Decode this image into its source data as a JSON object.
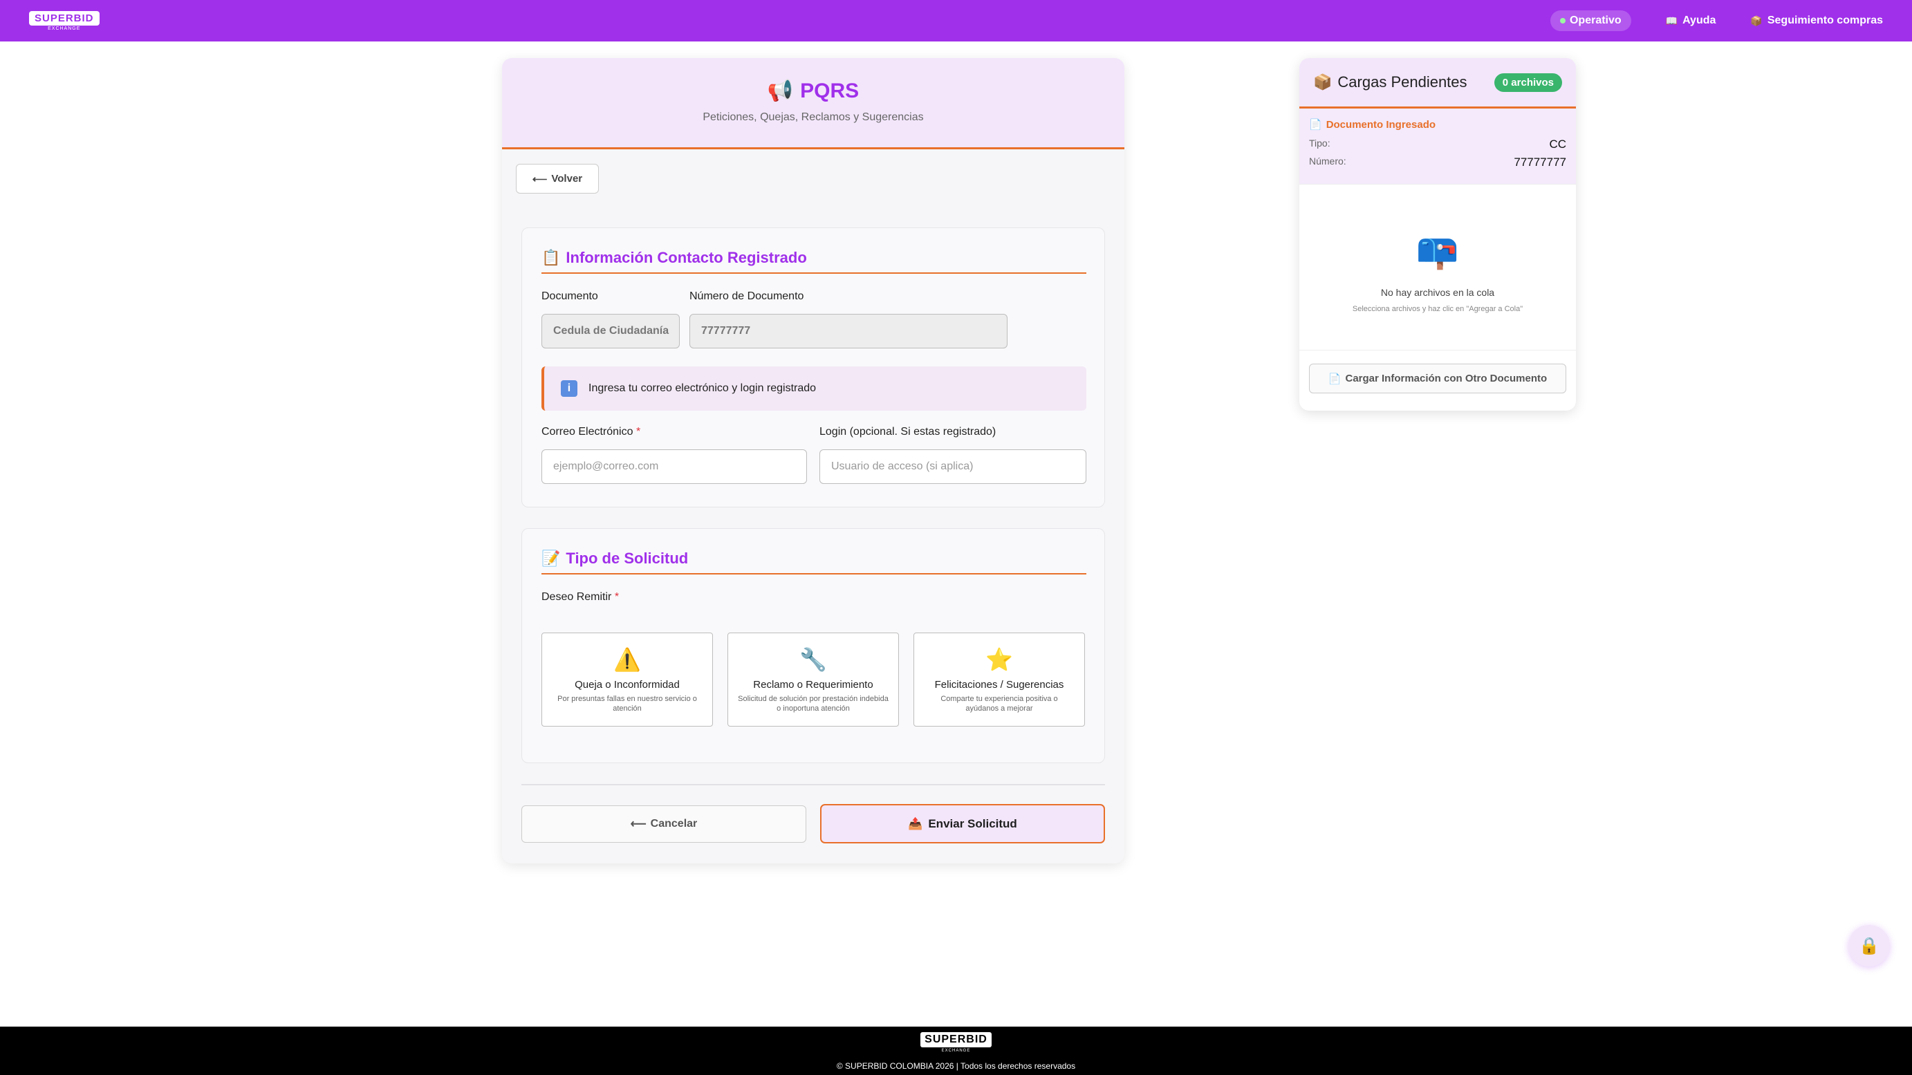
{
  "header": {
    "logo": "SUPERBID",
    "logo_sub": "EXCHANGE",
    "status": "Operativo",
    "help": "Ayuda",
    "tracking": "Seguimiento compras"
  },
  "main": {
    "title": "PQRS",
    "subtitle": "Peticiones, Quejas, Reclamos y Sugerencias",
    "back_label": "Volver",
    "contact_section": {
      "title": "Información Contacto Registrado",
      "doc_label": "Documento",
      "doc_value": "Cedula de Ciudadanía",
      "number_label": "Número de Documento",
      "number_value": "77777777",
      "info_text": "Ingresa tu correo electrónico y login registrado",
      "email_label": "Correo Electrónico",
      "email_placeholder": "ejemplo@correo.com",
      "login_label": "Login (opcional. Si estas registrado)",
      "login_placeholder": "Usuario de acceso (si aplica)"
    },
    "request_section": {
      "title": "Tipo de Solicitud",
      "remit_label": "Deseo Remitir",
      "options": [
        {
          "title": "Queja o Inconformidad",
          "desc": "Por presuntas fallas en nuestro servicio o atención"
        },
        {
          "title": "Reclamo o Requerimiento",
          "desc": "Solicitud de solución por prestación indebida o inoportuna atención"
        },
        {
          "title": "Felicitaciones / Sugerencias",
          "desc": "Comparte tu experiencia positiva o ayúdanos a mejorar"
        }
      ]
    },
    "cancel_label": "Cancelar",
    "send_label": "Enviar Solicitud"
  },
  "side": {
    "title": "Cargas Pendientes",
    "badge": "0 archivos",
    "doc_title": "Documento Ingresado",
    "type_key": "Tipo:",
    "type_val": "CC",
    "number_key": "Número:",
    "number_val": "77777777",
    "empty_title": "No hay archivos en la cola",
    "empty_sub": "Selecciona archivos y haz clic en \"Agregar a Cola\"",
    "other_btn": "Cargar Información con Otro Documento"
  },
  "footer": {
    "logo": "SUPERBID",
    "logo_sub": "EXCHANGE",
    "copyright": "© SUPERBID COLOMBIA 2026 | Todos los derechos reservados"
  },
  "colors": {
    "brand": "#a030ea",
    "accent": "#e8702a",
    "status_green": "#39b56c"
  }
}
